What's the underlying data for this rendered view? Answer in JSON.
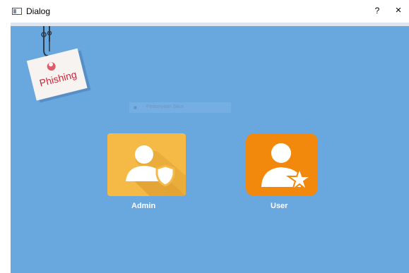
{
  "window": {
    "title": "Dialog",
    "help_label": "?",
    "close_label": "×"
  },
  "logo": {
    "text": "Phishing"
  },
  "search": {
    "placeholder_text": "Pertanyaan Situs"
  },
  "tiles": [
    {
      "label": "Admin",
      "icon": "admin-shield-icon",
      "color": "#f5b945"
    },
    {
      "label": "User",
      "icon": "user-star-icon",
      "color": "#f2890c"
    }
  ],
  "colors": {
    "background": "#69a7df",
    "logo_text": "#d1233a"
  }
}
